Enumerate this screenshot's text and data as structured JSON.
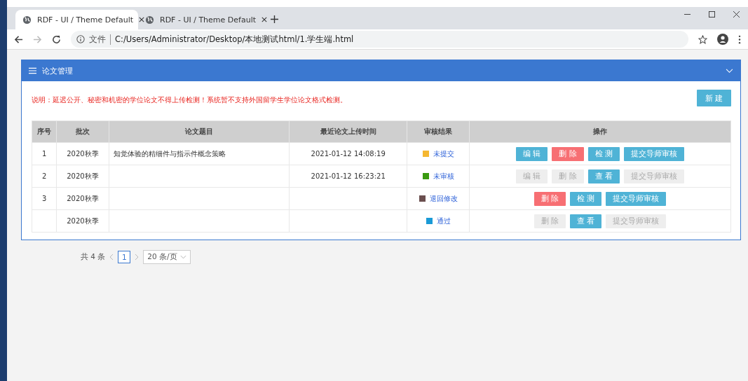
{
  "tabs": [
    {
      "title": "RDF - UI / Theme Default",
      "selected": true
    },
    {
      "title": "RDF - UI / Theme Default",
      "selected": false
    }
  ],
  "address": {
    "security": "文件",
    "url": "C:/Users/Administrator/Desktop/本地测试html/1.学生端.html"
  },
  "panel": {
    "title": "论文管理",
    "notice": "说明：延迟公开、秘密和机密的学位论文不得上传检测！系统暂不支持外国留学生学位论文格式检测。",
    "new_button": "新 建"
  },
  "table": {
    "columns": [
      "序号",
      "批次",
      "论文题目",
      "最近论文上传时间",
      "审核结果",
      "操作"
    ],
    "rows": [
      {
        "no": "1",
        "batch": "2020秋季",
        "title": "知觉体验的精细件与指示件概念策略",
        "time": "2021-01-12 14:08:19",
        "status": "未提交",
        "color": "#f5b731",
        "actions": [
          {
            "label": "编 辑",
            "kind": "info",
            "disabled": false
          },
          {
            "label": "删 除",
            "kind": "danger",
            "disabled": false
          },
          {
            "label": "检 测",
            "kind": "info",
            "disabled": false
          },
          {
            "label": "提交导师审核",
            "kind": "info",
            "disabled": false
          }
        ]
      },
      {
        "no": "2",
        "batch": "2020秋季",
        "time": "2021-01-12 16:23:21",
        "status": "未审核",
        "color": "#3a9a10",
        "actions": [
          {
            "label": "编 辑",
            "kind": "info",
            "disabled": true
          },
          {
            "label": "删 除",
            "kind": "danger",
            "disabled": true
          },
          {
            "label": "查 看",
            "kind": "info",
            "disabled": false
          },
          {
            "label": "提交导师审核",
            "kind": "info",
            "disabled": true
          }
        ]
      },
      {
        "no": "3",
        "batch": "2020秋季",
        "status": "退回修改",
        "color": "#6b4f4f",
        "actions": [
          {
            "label": "删 除",
            "kind": "danger",
            "disabled": false
          },
          {
            "label": "检 测",
            "kind": "info",
            "disabled": false
          },
          {
            "label": "提交导师审核",
            "kind": "info",
            "disabled": false
          }
        ]
      },
      {
        "batch": "2020秋季",
        "status": "通过",
        "color": "#1a9ad6",
        "actions": [
          {
            "label": "删 除",
            "kind": "danger",
            "disabled": true
          },
          {
            "label": "查 看",
            "kind": "info",
            "disabled": false
          },
          {
            "label": "提交导师审核",
            "kind": "info",
            "disabled": true
          }
        ]
      }
    ]
  },
  "pagination": {
    "total": "共 4 条",
    "pages": [
      {
        "label": "1",
        "selected": true
      }
    ],
    "page_size": "20 条/页"
  }
}
